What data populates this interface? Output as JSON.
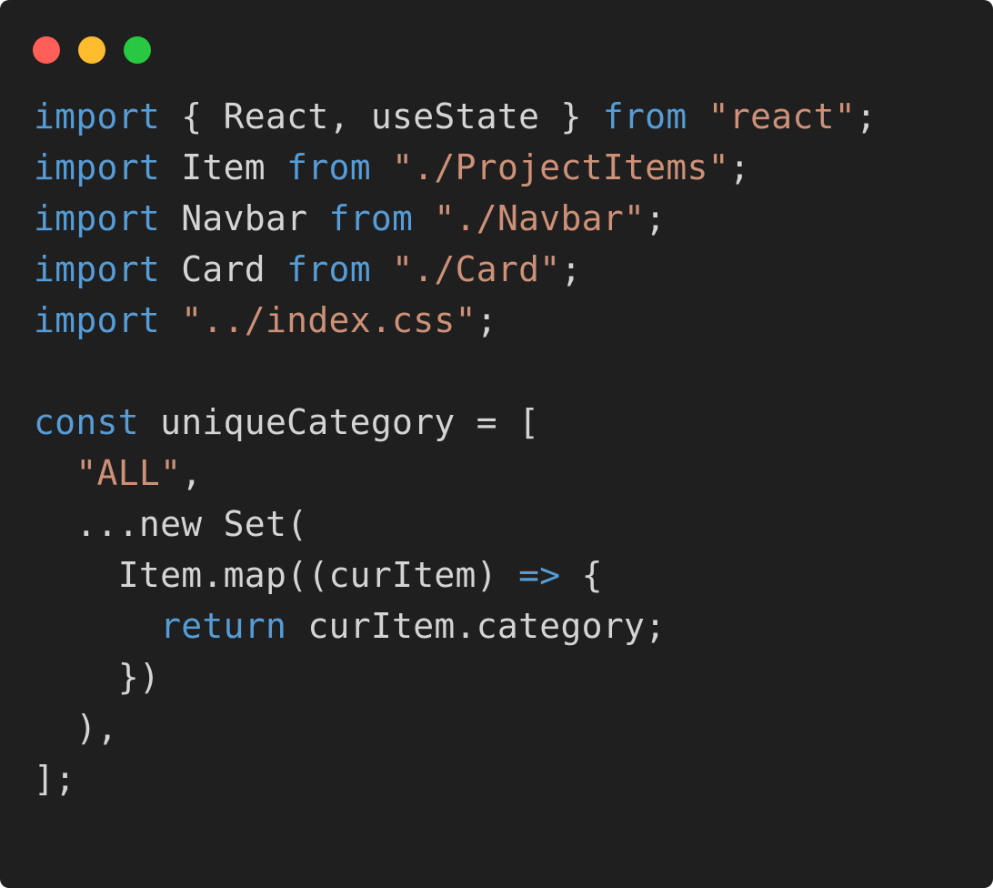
{
  "window": {
    "background": "#1f1f1f",
    "controls": [
      {
        "name": "close",
        "color": "#ff5f57"
      },
      {
        "name": "minimize",
        "color": "#febc2e"
      },
      {
        "name": "zoom",
        "color": "#28c840"
      }
    ]
  },
  "colors": {
    "keyword": "#569cd6",
    "string": "#ce9178",
    "text": "#d4d4d4"
  },
  "code_lines": [
    [
      {
        "t": "import",
        "c": "keyword"
      },
      {
        "t": " { React, useState } ",
        "c": "text"
      },
      {
        "t": "from",
        "c": "keyword"
      },
      {
        "t": " ",
        "c": "text"
      },
      {
        "t": "\"react\"",
        "c": "string"
      },
      {
        "t": ";",
        "c": "text"
      }
    ],
    [
      {
        "t": "import",
        "c": "keyword"
      },
      {
        "t": " Item ",
        "c": "text"
      },
      {
        "t": "from",
        "c": "keyword"
      },
      {
        "t": " ",
        "c": "text"
      },
      {
        "t": "\"./ProjectItems\"",
        "c": "string"
      },
      {
        "t": ";",
        "c": "text"
      }
    ],
    [
      {
        "t": "import",
        "c": "keyword"
      },
      {
        "t": " Navbar ",
        "c": "text"
      },
      {
        "t": "from",
        "c": "keyword"
      },
      {
        "t": " ",
        "c": "text"
      },
      {
        "t": "\"./Navbar\"",
        "c": "string"
      },
      {
        "t": ";",
        "c": "text"
      }
    ],
    [
      {
        "t": "import",
        "c": "keyword"
      },
      {
        "t": " Card ",
        "c": "text"
      },
      {
        "t": "from",
        "c": "keyword"
      },
      {
        "t": " ",
        "c": "text"
      },
      {
        "t": "\"./Card\"",
        "c": "string"
      },
      {
        "t": ";",
        "c": "text"
      }
    ],
    [
      {
        "t": "import",
        "c": "keyword"
      },
      {
        "t": " ",
        "c": "text"
      },
      {
        "t": "\"../index.css\"",
        "c": "string"
      },
      {
        "t": ";",
        "c": "text"
      }
    ],
    [],
    [
      {
        "t": "const",
        "c": "keyword"
      },
      {
        "t": " uniqueCategory = [",
        "c": "text"
      }
    ],
    [
      {
        "t": "  ",
        "c": "text"
      },
      {
        "t": "\"ALL\"",
        "c": "string"
      },
      {
        "t": ",",
        "c": "text"
      }
    ],
    [
      {
        "t": "  ...new Set(",
        "c": "text"
      }
    ],
    [
      {
        "t": "    Item.map((curItem) ",
        "c": "text"
      },
      {
        "t": "=>",
        "c": "keyword"
      },
      {
        "t": " {",
        "c": "text"
      }
    ],
    [
      {
        "t": "      ",
        "c": "text"
      },
      {
        "t": "return",
        "c": "keyword"
      },
      {
        "t": " curItem.category;",
        "c": "text"
      }
    ],
    [
      {
        "t": "    })",
        "c": "text"
      }
    ],
    [
      {
        "t": "  ),",
        "c": "text"
      }
    ],
    [
      {
        "t": "];",
        "c": "text"
      }
    ]
  ]
}
